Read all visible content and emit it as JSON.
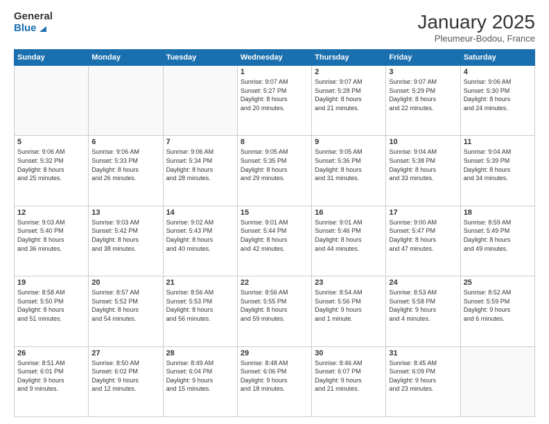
{
  "header": {
    "logo_general": "General",
    "logo_blue": "Blue",
    "month_title": "January 2025",
    "location": "Pleumeur-Bodou, France"
  },
  "days_of_week": [
    "Sunday",
    "Monday",
    "Tuesday",
    "Wednesday",
    "Thursday",
    "Friday",
    "Saturday"
  ],
  "weeks": [
    [
      {
        "day": "",
        "info": ""
      },
      {
        "day": "",
        "info": ""
      },
      {
        "day": "",
        "info": ""
      },
      {
        "day": "1",
        "info": "Sunrise: 9:07 AM\nSunset: 5:27 PM\nDaylight: 8 hours\nand 20 minutes."
      },
      {
        "day": "2",
        "info": "Sunrise: 9:07 AM\nSunset: 5:28 PM\nDaylight: 8 hours\nand 21 minutes."
      },
      {
        "day": "3",
        "info": "Sunrise: 9:07 AM\nSunset: 5:29 PM\nDaylight: 8 hours\nand 22 minutes."
      },
      {
        "day": "4",
        "info": "Sunrise: 9:06 AM\nSunset: 5:30 PM\nDaylight: 8 hours\nand 24 minutes."
      }
    ],
    [
      {
        "day": "5",
        "info": "Sunrise: 9:06 AM\nSunset: 5:32 PM\nDaylight: 8 hours\nand 25 minutes."
      },
      {
        "day": "6",
        "info": "Sunrise: 9:06 AM\nSunset: 5:33 PM\nDaylight: 8 hours\nand 26 minutes."
      },
      {
        "day": "7",
        "info": "Sunrise: 9:06 AM\nSunset: 5:34 PM\nDaylight: 8 hours\nand 28 minutes."
      },
      {
        "day": "8",
        "info": "Sunrise: 9:05 AM\nSunset: 5:35 PM\nDaylight: 8 hours\nand 29 minutes."
      },
      {
        "day": "9",
        "info": "Sunrise: 9:05 AM\nSunset: 5:36 PM\nDaylight: 8 hours\nand 31 minutes."
      },
      {
        "day": "10",
        "info": "Sunrise: 9:04 AM\nSunset: 5:38 PM\nDaylight: 8 hours\nand 33 minutes."
      },
      {
        "day": "11",
        "info": "Sunrise: 9:04 AM\nSunset: 5:39 PM\nDaylight: 8 hours\nand 34 minutes."
      }
    ],
    [
      {
        "day": "12",
        "info": "Sunrise: 9:03 AM\nSunset: 5:40 PM\nDaylight: 8 hours\nand 36 minutes."
      },
      {
        "day": "13",
        "info": "Sunrise: 9:03 AM\nSunset: 5:42 PM\nDaylight: 8 hours\nand 38 minutes."
      },
      {
        "day": "14",
        "info": "Sunrise: 9:02 AM\nSunset: 5:43 PM\nDaylight: 8 hours\nand 40 minutes."
      },
      {
        "day": "15",
        "info": "Sunrise: 9:01 AM\nSunset: 5:44 PM\nDaylight: 8 hours\nand 42 minutes."
      },
      {
        "day": "16",
        "info": "Sunrise: 9:01 AM\nSunset: 5:46 PM\nDaylight: 8 hours\nand 44 minutes."
      },
      {
        "day": "17",
        "info": "Sunrise: 9:00 AM\nSunset: 5:47 PM\nDaylight: 8 hours\nand 47 minutes."
      },
      {
        "day": "18",
        "info": "Sunrise: 8:59 AM\nSunset: 5:49 PM\nDaylight: 8 hours\nand 49 minutes."
      }
    ],
    [
      {
        "day": "19",
        "info": "Sunrise: 8:58 AM\nSunset: 5:50 PM\nDaylight: 8 hours\nand 51 minutes."
      },
      {
        "day": "20",
        "info": "Sunrise: 8:57 AM\nSunset: 5:52 PM\nDaylight: 8 hours\nand 54 minutes."
      },
      {
        "day": "21",
        "info": "Sunrise: 8:56 AM\nSunset: 5:53 PM\nDaylight: 8 hours\nand 56 minutes."
      },
      {
        "day": "22",
        "info": "Sunrise: 8:56 AM\nSunset: 5:55 PM\nDaylight: 8 hours\nand 59 minutes."
      },
      {
        "day": "23",
        "info": "Sunrise: 8:54 AM\nSunset: 5:56 PM\nDaylight: 9 hours\nand 1 minute."
      },
      {
        "day": "24",
        "info": "Sunrise: 8:53 AM\nSunset: 5:58 PM\nDaylight: 9 hours\nand 4 minutes."
      },
      {
        "day": "25",
        "info": "Sunrise: 8:52 AM\nSunset: 5:59 PM\nDaylight: 9 hours\nand 6 minutes."
      }
    ],
    [
      {
        "day": "26",
        "info": "Sunrise: 8:51 AM\nSunset: 6:01 PM\nDaylight: 9 hours\nand 9 minutes."
      },
      {
        "day": "27",
        "info": "Sunrise: 8:50 AM\nSunset: 6:02 PM\nDaylight: 9 hours\nand 12 minutes."
      },
      {
        "day": "28",
        "info": "Sunrise: 8:49 AM\nSunset: 6:04 PM\nDaylight: 9 hours\nand 15 minutes."
      },
      {
        "day": "29",
        "info": "Sunrise: 8:48 AM\nSunset: 6:06 PM\nDaylight: 9 hours\nand 18 minutes."
      },
      {
        "day": "30",
        "info": "Sunrise: 8:46 AM\nSunset: 6:07 PM\nDaylight: 9 hours\nand 21 minutes."
      },
      {
        "day": "31",
        "info": "Sunrise: 8:45 AM\nSunset: 6:09 PM\nDaylight: 9 hours\nand 23 minutes."
      },
      {
        "day": "",
        "info": ""
      }
    ]
  ]
}
